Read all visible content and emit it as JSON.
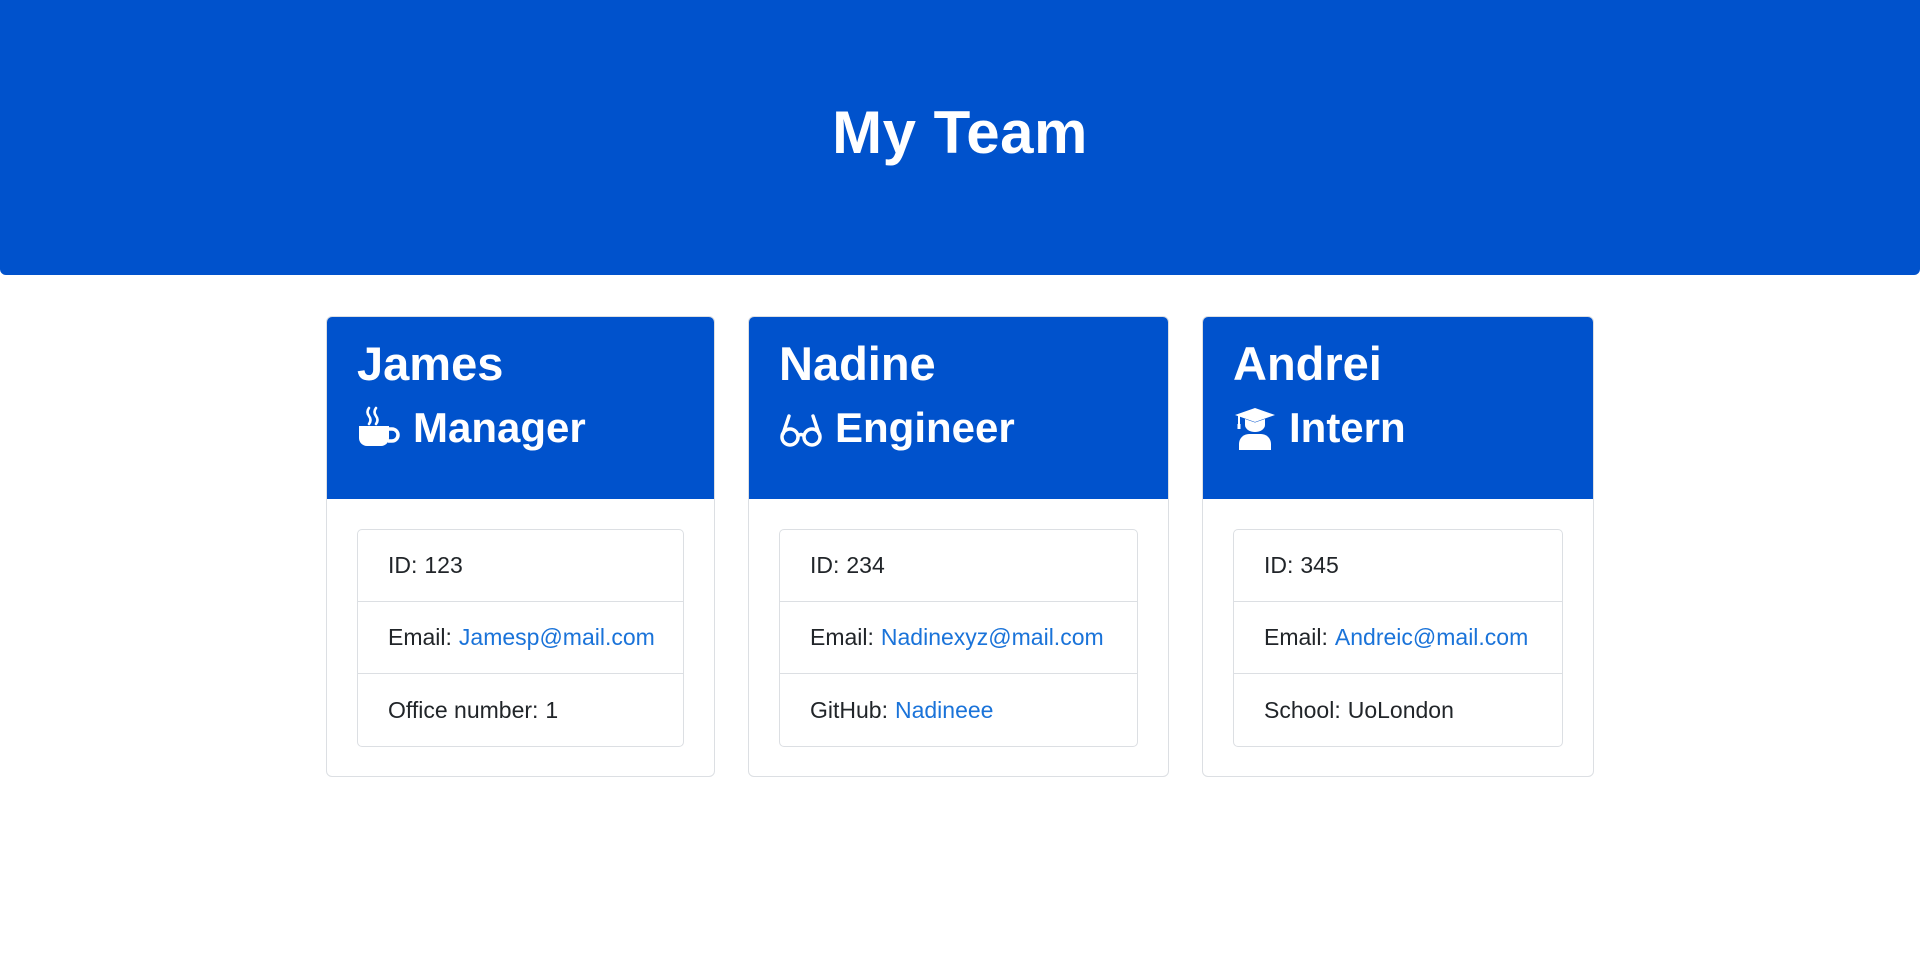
{
  "header": {
    "title": "My Team"
  },
  "colors": {
    "primary": "#0052cc",
    "link": "#1a73d9"
  },
  "team": [
    {
      "name": "James",
      "role": "Manager",
      "role_icon": "coffee-icon",
      "id_label": "ID:",
      "id": "123",
      "email_label": "Email:",
      "email": "Jamesp@mail.com",
      "extra_label": "Office number:",
      "extra_value": "1"
    },
    {
      "name": "Nadine",
      "role": "Engineer",
      "role_icon": "glasses-icon",
      "id_label": "ID:",
      "id": "234",
      "email_label": "Email:",
      "email": "Nadinexyz@mail.com",
      "extra_label": "GitHub:",
      "extra_value": "Nadineee"
    },
    {
      "name": "Andrei",
      "role": "Intern",
      "role_icon": "graduate-icon",
      "id_label": "ID:",
      "id": "345",
      "email_label": "Email:",
      "email": "Andreic@mail.com",
      "extra_label": "School:",
      "extra_value": "UoLondon"
    }
  ]
}
